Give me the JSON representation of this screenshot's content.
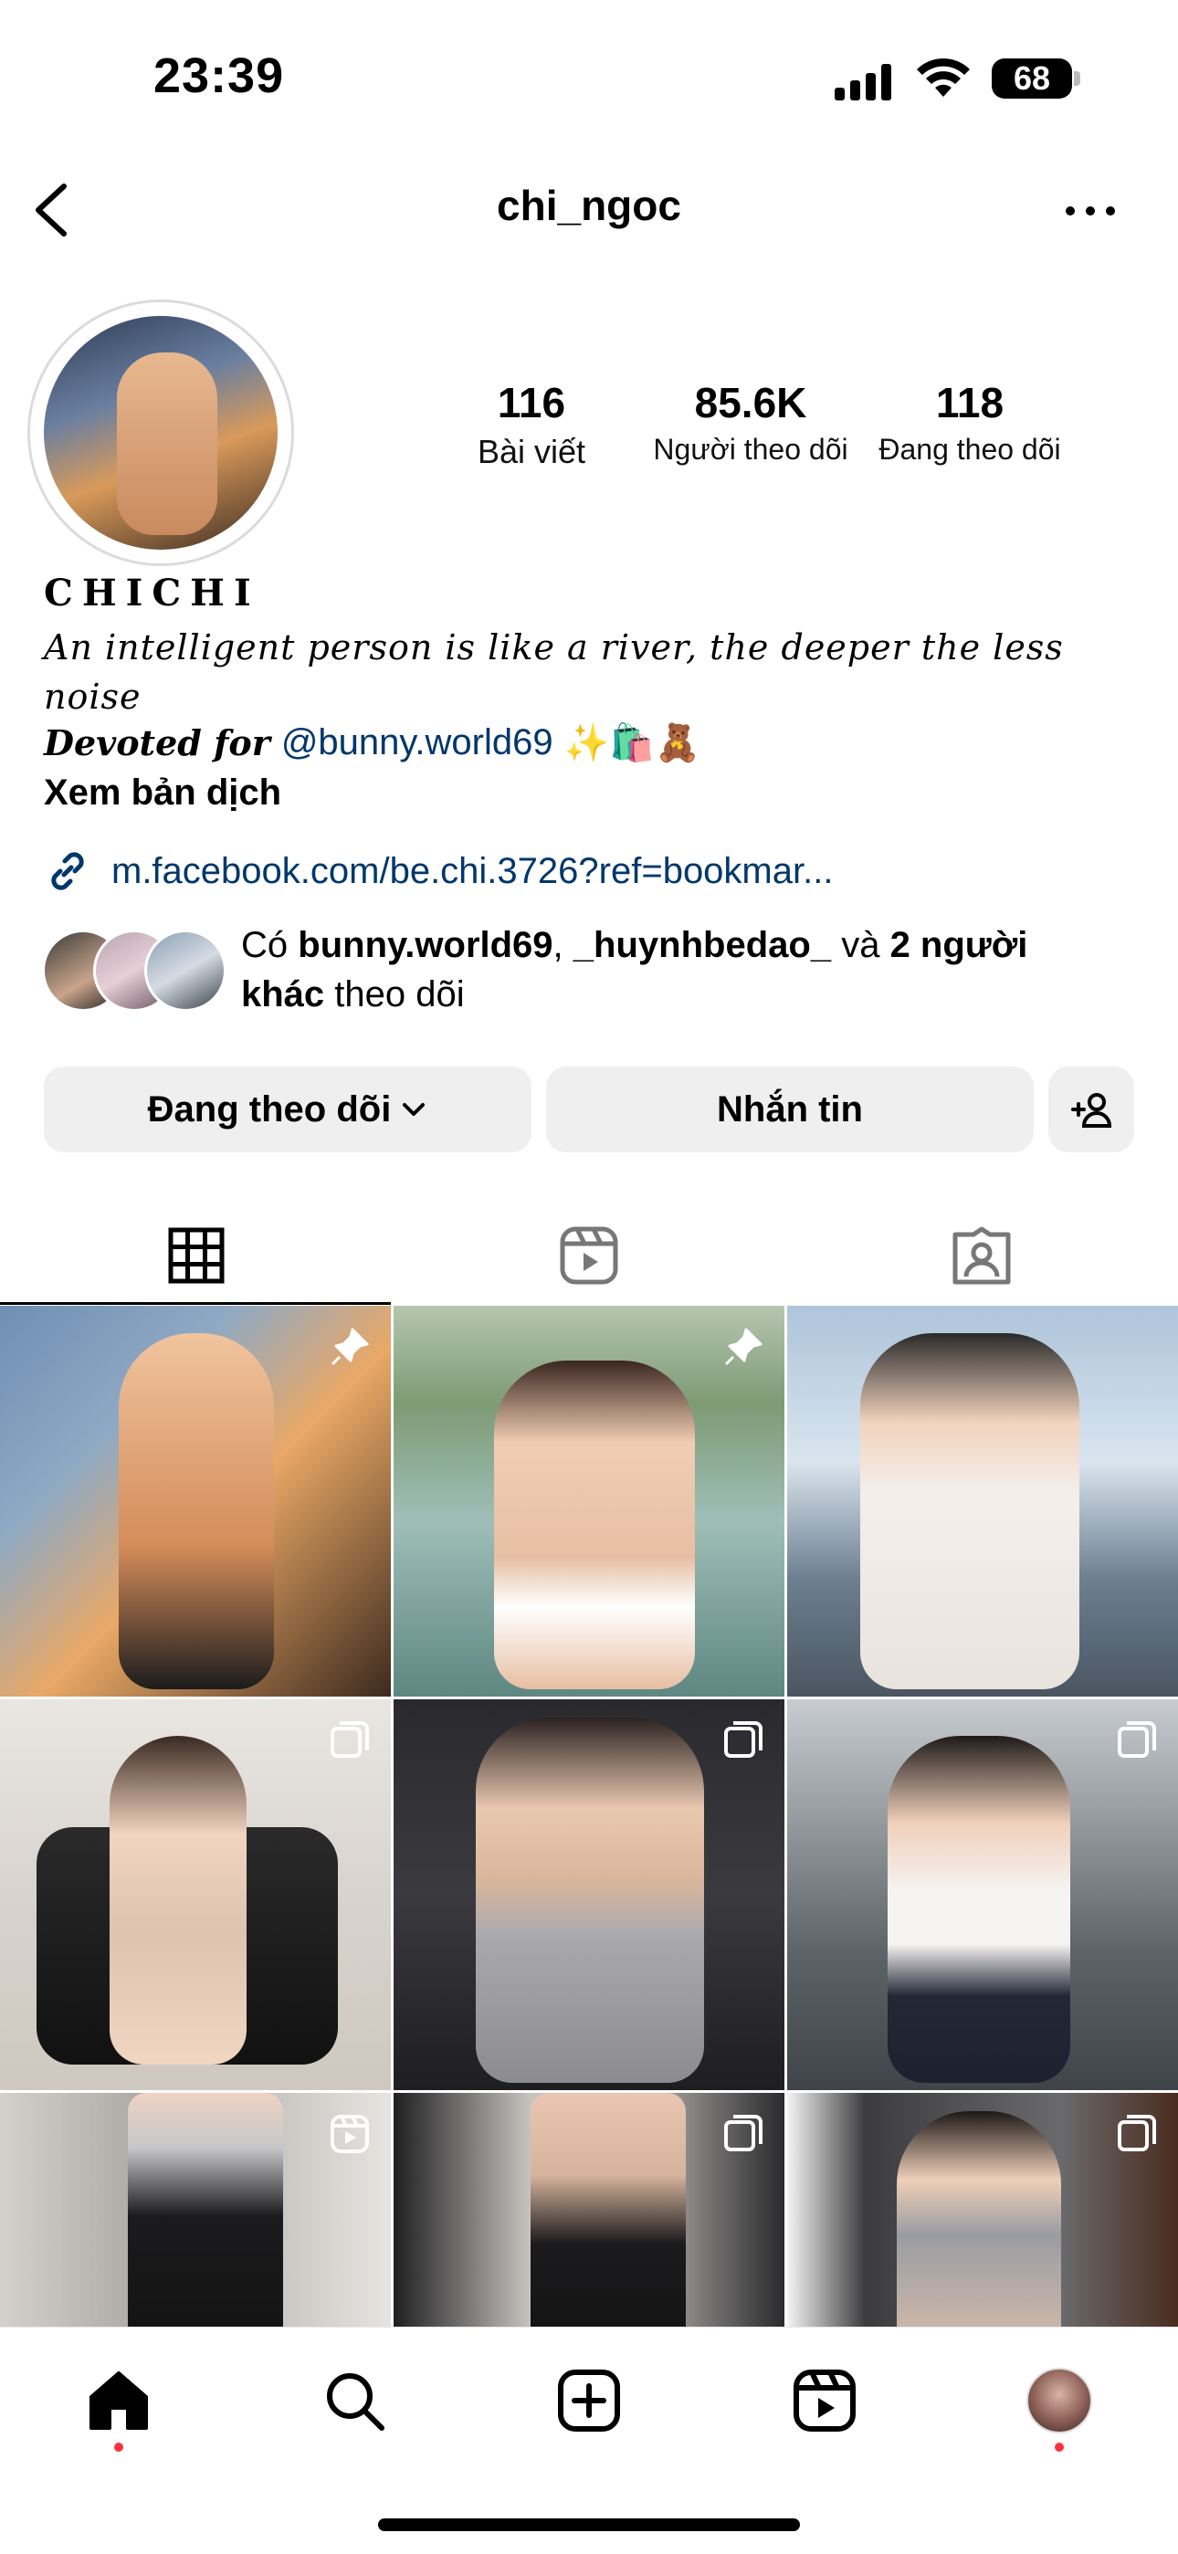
{
  "status_bar": {
    "time": "23:39",
    "battery": "68"
  },
  "header": {
    "username": "chi_ngoc"
  },
  "stats": [
    {
      "value": "116",
      "label": "Bài viết"
    },
    {
      "value": "85.6K",
      "label": "Người theo dõi"
    },
    {
      "value": "118",
      "label": "Đang theo dõi"
    }
  ],
  "bio": {
    "display_name": "CHICHI",
    "quote": "An intelligent person is like a river, the deeper the less noise",
    "devoted_label": "Devoted for",
    "mention": "@bunny.world69",
    "emojis": "✨🛍️🧸",
    "translate": "Xem bản dịch",
    "link": "m.facebook.com/be.chi.3726?ref=bookmar..."
  },
  "followed_by": {
    "prefix": "Có",
    "user1": "bunny.world69",
    "sep": ",",
    "user2": "_huynhbedao_",
    "and": "và",
    "others": "2 người khác",
    "suffix": "theo dõi"
  },
  "buttons": {
    "following": "Đang theo dõi",
    "message": "Nhắn tin"
  },
  "grid": [
    {
      "type": "pinned"
    },
    {
      "type": "pinned"
    },
    {
      "type": "none"
    },
    {
      "type": "carousel"
    },
    {
      "type": "carousel"
    },
    {
      "type": "carousel"
    },
    {
      "type": "reel"
    },
    {
      "type": "carousel"
    },
    {
      "type": "carousel"
    }
  ],
  "colors": {
    "link": "#00376b",
    "button_bg": "#efefef",
    "notification_dot": "#ff3040"
  }
}
